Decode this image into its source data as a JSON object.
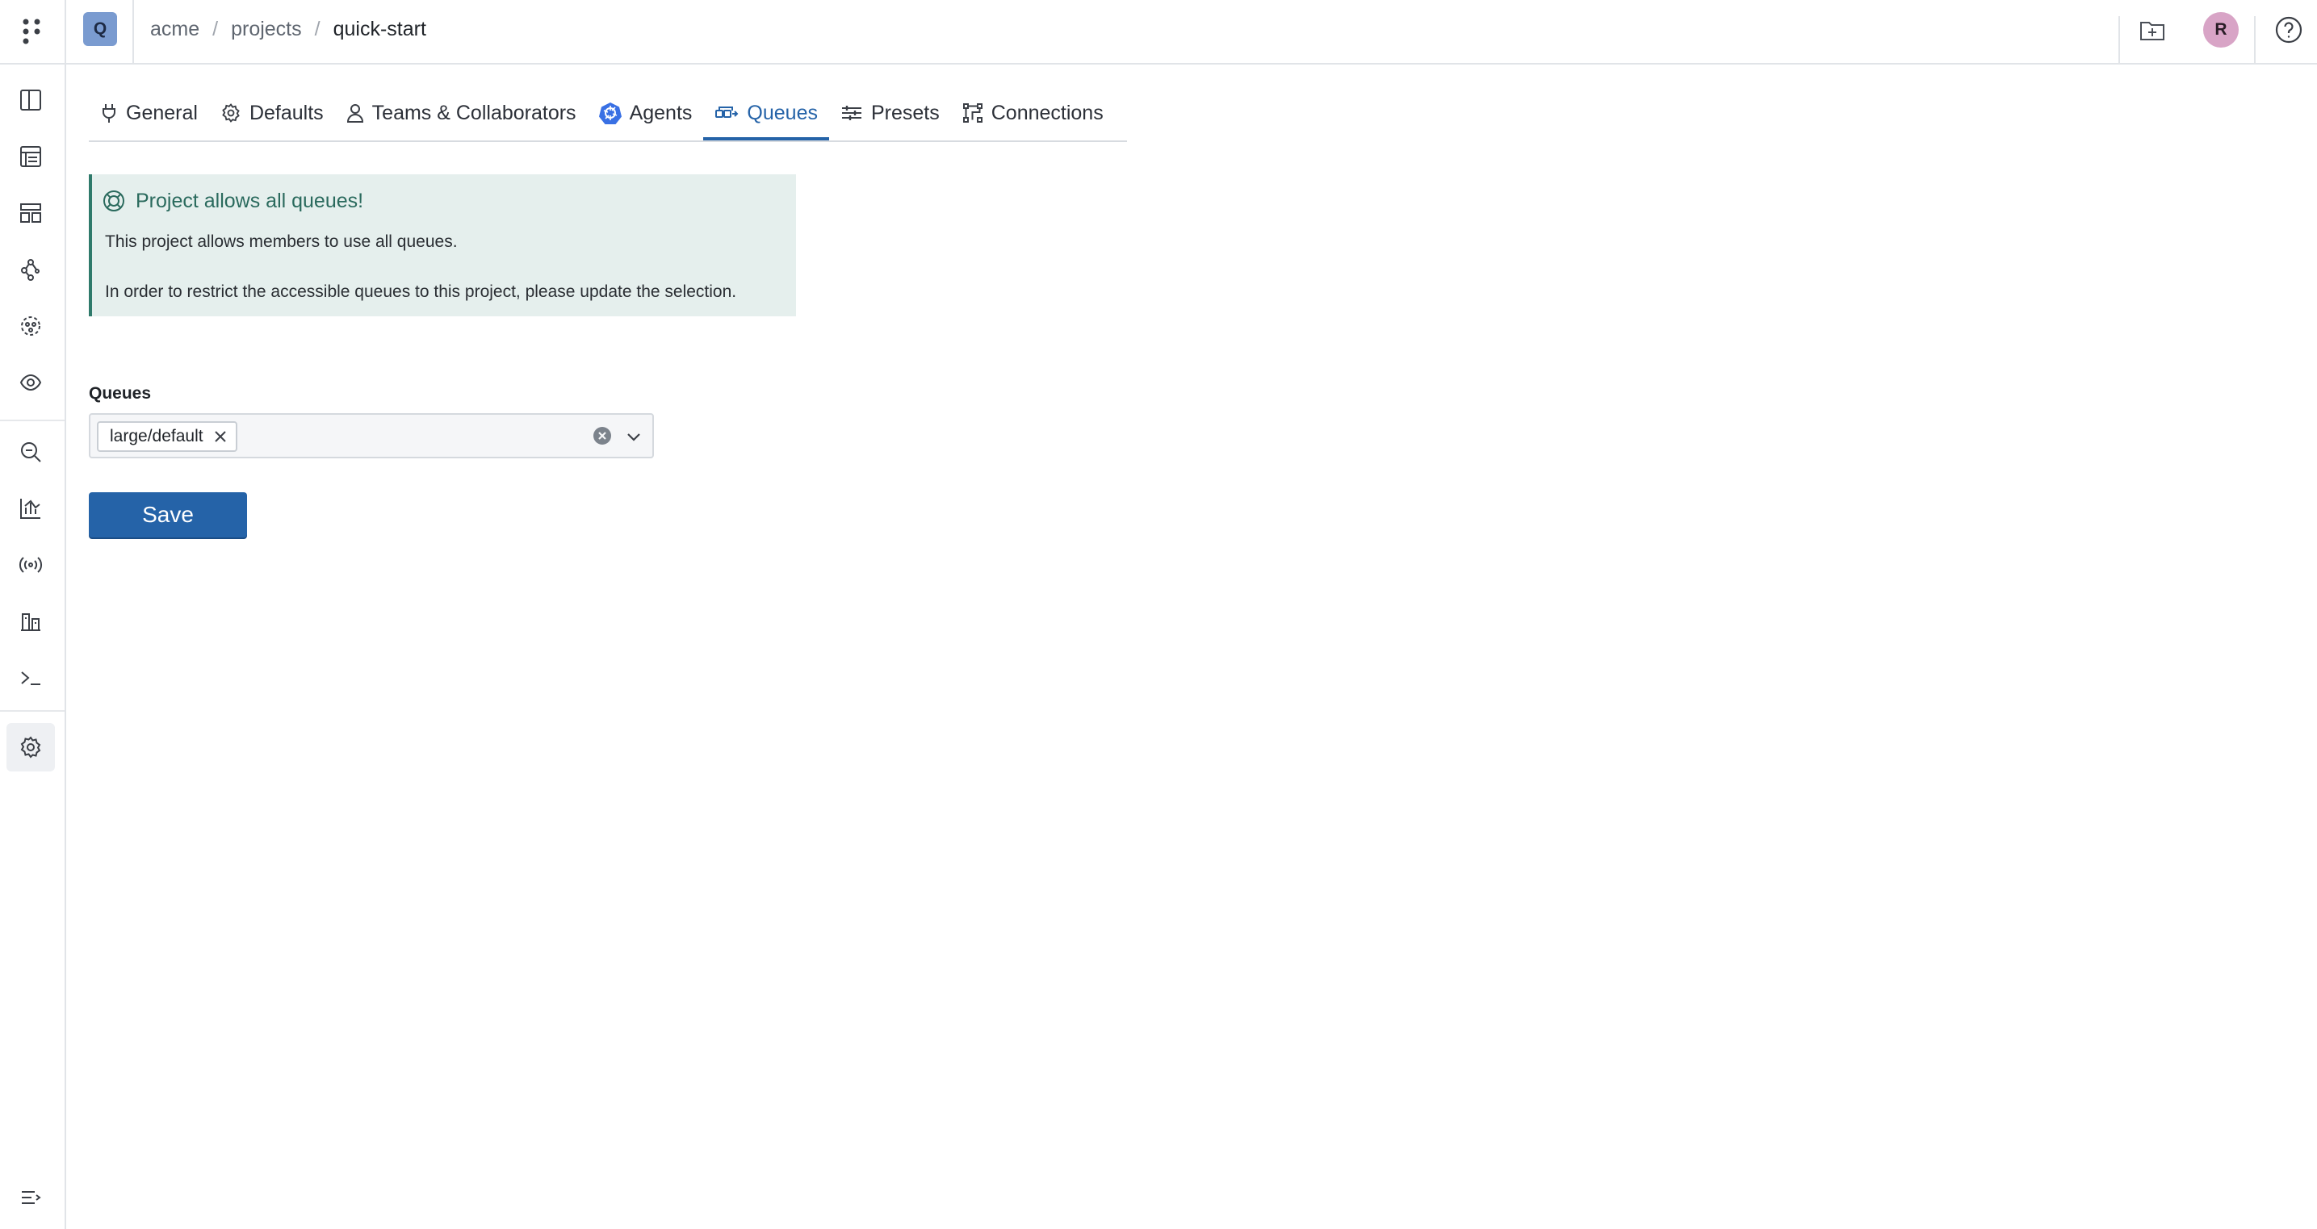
{
  "breadcrumb": {
    "project_initial": "Q",
    "org": "acme",
    "section": "projects",
    "current": "quick-start",
    "separator": "/"
  },
  "user": {
    "avatar_initial": "R"
  },
  "tabs": [
    {
      "label": "General",
      "icon": "plug-icon",
      "active": false
    },
    {
      "label": "Defaults",
      "icon": "gear-icon",
      "active": false
    },
    {
      "label": "Teams & Collaborators",
      "icon": "user-icon",
      "active": false
    },
    {
      "label": "Agents",
      "icon": "kubernetes-icon",
      "active": false
    },
    {
      "label": "Queues",
      "icon": "queue-icon",
      "active": true
    },
    {
      "label": "Presets",
      "icon": "presets-icon",
      "active": false
    },
    {
      "label": "Connections",
      "icon": "connections-icon",
      "active": false
    }
  ],
  "callout": {
    "title": "Project allows all queues!",
    "line1": "This project allows members to use all queues.",
    "line2": "In order to restrict the accessible queues to this project, please update the selection."
  },
  "form": {
    "queues_label": "Queues",
    "selected_queues": [
      "large/default"
    ],
    "save_label": "Save"
  },
  "colors": {
    "accent": "#2563a8",
    "callout_bg": "#e5efed",
    "callout_border": "#2f7a6b",
    "project_badge": "#7a9bd0",
    "avatar": "#d8a4c6"
  }
}
